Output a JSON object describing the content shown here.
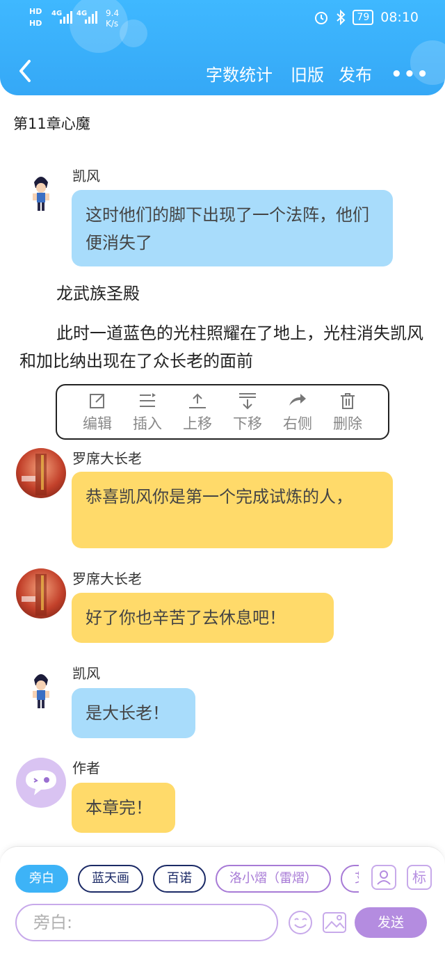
{
  "status": {
    "hd1": "HD",
    "hd2": "HD",
    "signal1": "4G",
    "signal2": "4G",
    "speed": "9.4",
    "speed_unit": "K/s",
    "battery": "79",
    "time": "08:10"
  },
  "nav": {
    "word_count": "字数统计",
    "old_version": "旧版",
    "publish": "发布",
    "more": "•••"
  },
  "chapter_title": "第11章心魔",
  "messages": [
    {
      "speaker": "凯风",
      "text": "这时他们的脚下出现了一个法阵，他们便消失了",
      "avatar": "boy-character-icon",
      "color": "#a8dcfb"
    },
    {
      "speaker": "罗席大长老",
      "text": "恭喜凯风你是第一个完成试炼的人，",
      "avatar": "elder-character-icon",
      "color": "#ffda6a"
    },
    {
      "speaker": "罗席大长老",
      "text": "好了你也辛苦了去休息吧！",
      "avatar": "elder-character-icon",
      "color": "#ffda6a"
    },
    {
      "speaker": "凯风",
      "text": "是大长老！",
      "avatar": "boy-character-icon",
      "color": "#a8dcfb"
    },
    {
      "speaker": "作者",
      "text": "本章完！",
      "avatar": "author-chat-icon",
      "color": "#ffda6a"
    }
  ],
  "narration": {
    "line1": "龙武族圣殿",
    "line2": "此时一道蓝色的光柱照耀在了地上，光柱消失凯风和加比纳出现在了众长老的面前"
  },
  "toolbar": {
    "edit": "编辑",
    "insert": "插入",
    "move_up": "上移",
    "move_down": "下移",
    "right_side": "右侧",
    "delete": "删除"
  },
  "bottom": {
    "chips": [
      "旁白",
      "蓝天画",
      "百诺",
      "洛小熠（雷熠）",
      "艾"
    ],
    "mark_label": "标",
    "input_placeholder": "旁白:",
    "send": "发送"
  }
}
